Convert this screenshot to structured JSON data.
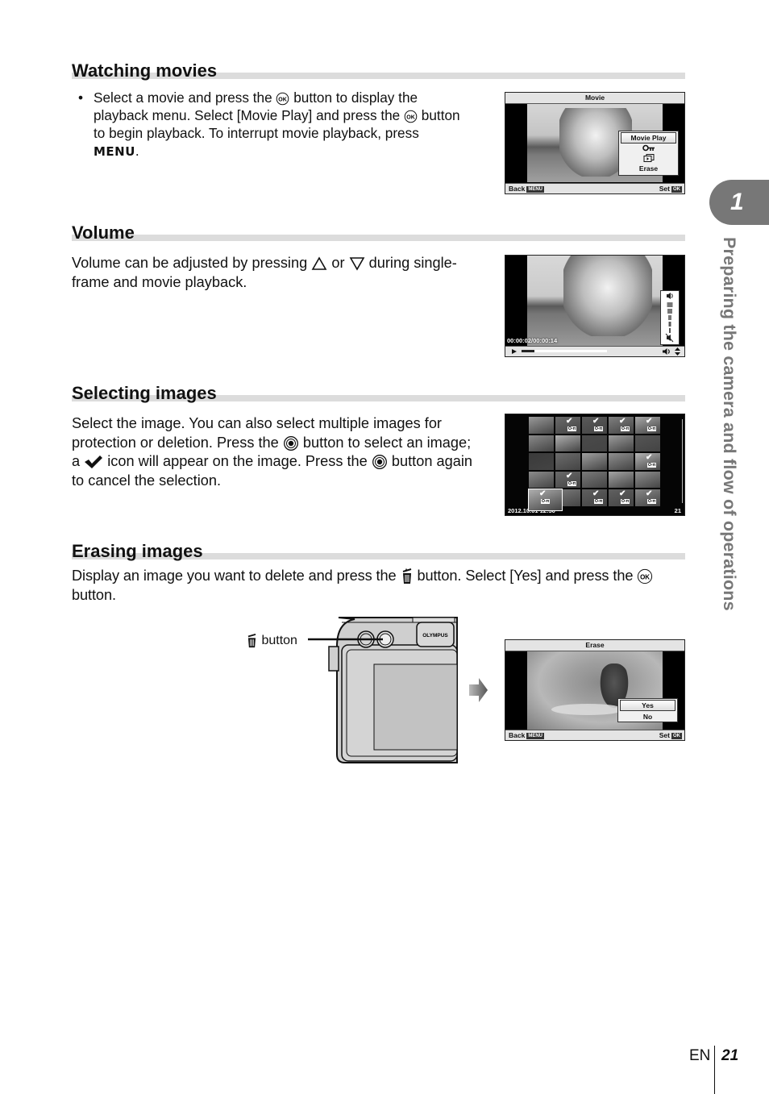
{
  "sections": {
    "watching": {
      "title": "Watching movies",
      "bullet": "•",
      "text_1": "Select a movie and press the",
      "text_2": "button to display the playback menu. Select [Movie Play] and press the",
      "text_3": "button to begin playback. To interrupt movie playback, press",
      "menu_word": "MENU",
      "text_4": "."
    },
    "volume": {
      "title": "Volume",
      "text_1": "Volume can be adjusted by pressing",
      "text_or": "or",
      "text_2": "during single-frame and movie playback."
    },
    "selecting": {
      "title": "Selecting images",
      "text_1": "Select the image. You can also select multiple images for protection or deletion. Press the",
      "text_2": "button to select an image; a",
      "text_3": "icon will appear on the image. Press the",
      "text_4": "button again to cancel the selection."
    },
    "erasing": {
      "title": "Erasing images",
      "text_1": "Display an image you want to delete and press the",
      "text_2": "button. Select [Yes] and press the",
      "text_3": "button.",
      "callout_label": "button",
      "camera_brand": "OLYMPUS"
    }
  },
  "screens": {
    "movie_menu": {
      "title": "Movie",
      "menu_items": [
        "Movie Play",
        "protect-key-icon",
        "share-icon",
        "Erase"
      ],
      "selected": "Movie Play",
      "back_label": "Back",
      "back_key": "MENU",
      "set_label": "Set",
      "set_key": "OK"
    },
    "volume_playback": {
      "timecode": "00:00:02/00:00:14",
      "progress": 0.15,
      "volume_level": 0.4
    },
    "index_view": {
      "datetime": "2012.10.01 12:30",
      "frame_number": "21",
      "grid_cols": 5,
      "grid_rows": 5,
      "checked": [
        1,
        2,
        3,
        4,
        14,
        16,
        20,
        22,
        23,
        24
      ],
      "selected_cursor": 20
    },
    "erase_confirm": {
      "title": "Erase",
      "options": [
        "Yes",
        "No"
      ],
      "selected": "Yes",
      "back_label": "Back",
      "back_key": "MENU",
      "set_label": "Set",
      "set_key": "OK"
    }
  },
  "sidebar": {
    "chapter_number": "1",
    "chapter_title": "Preparing the camera and flow of operations"
  },
  "footer": {
    "language": "EN",
    "page_number": "21"
  }
}
